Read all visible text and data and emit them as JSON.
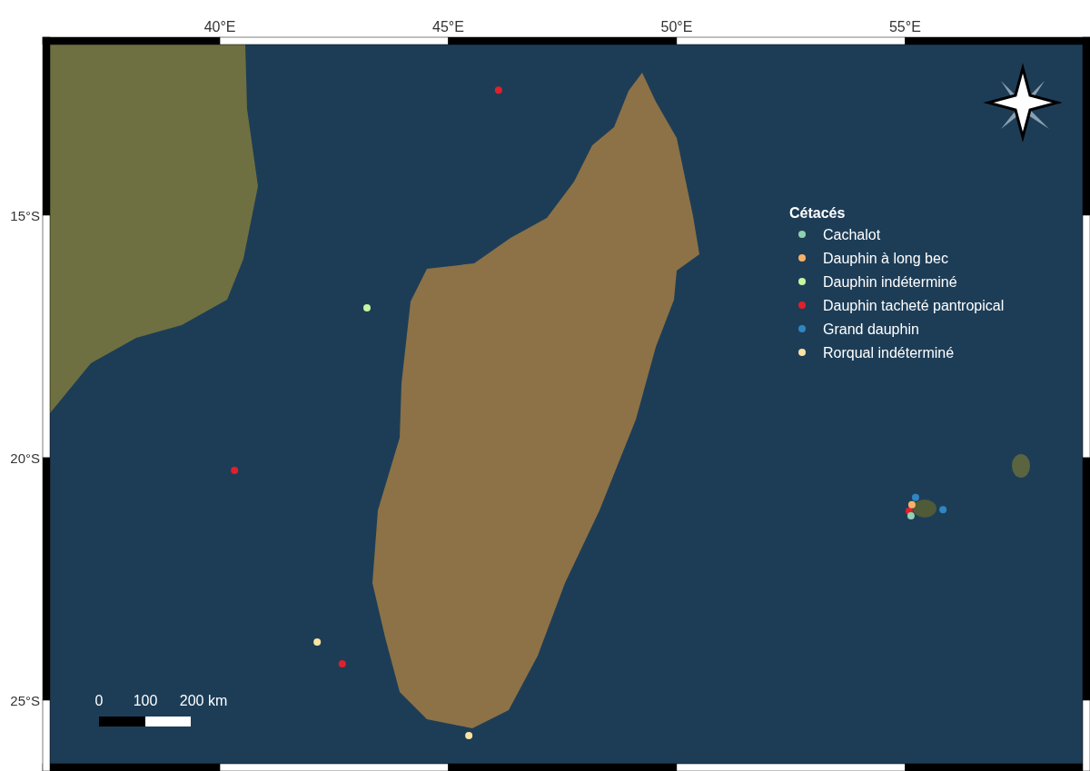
{
  "map": {
    "chart_data": {
      "type": "scatter",
      "title": "Cétacés",
      "legend": true,
      "xlim": [
        36.28,
        58.89
      ],
      "ylim": [
        -26.31,
        -11.48
      ],
      "xticks": [
        {
          "value": 40,
          "label": "40°E"
        },
        {
          "value": 45,
          "label": "45°E"
        },
        {
          "value": 50,
          "label": "50°E"
        },
        {
          "value": 55,
          "label": "55°E"
        }
      ],
      "yticks": [
        {
          "value": -15,
          "label": "15°S"
        },
        {
          "value": -20,
          "label": "20°S"
        },
        {
          "value": -25,
          "label": "25°S"
        }
      ],
      "series": [
        {
          "name": "Cachalot",
          "color": "#8fd1b0",
          "x": [
            55.13
          ],
          "values": [
            -21.2
          ]
        },
        {
          "name": "Dauphin à long bec",
          "color": "#f7b267",
          "x": [
            55.15
          ],
          "values": [
            -20.97
          ]
        },
        {
          "name": "Dauphin indéterminé",
          "color": "#c8f5a0",
          "x": [
            43.22
          ],
          "values": [
            -16.91
          ]
        },
        {
          "name": "Dauphin tacheté pantropical",
          "color": "#e0202a",
          "x": [
            46.1,
            40.32,
            42.68,
            55.09
          ],
          "values": [
            -12.42,
            -20.26,
            -24.25,
            -21.1
          ]
        },
        {
          "name": "Grand dauphin",
          "color": "#2f86c0",
          "x": [
            55.23,
            55.83
          ],
          "values": [
            -20.82,
            -21.07
          ]
        },
        {
          "name": "Rorqual indéterminé",
          "color": "#fbe3a0",
          "x": [
            42.13,
            45.45
          ],
          "values": [
            -23.8,
            -25.73
          ]
        }
      ]
    },
    "scale_bar": {
      "labels": [
        "0",
        "100",
        "200 km"
      ]
    }
  }
}
